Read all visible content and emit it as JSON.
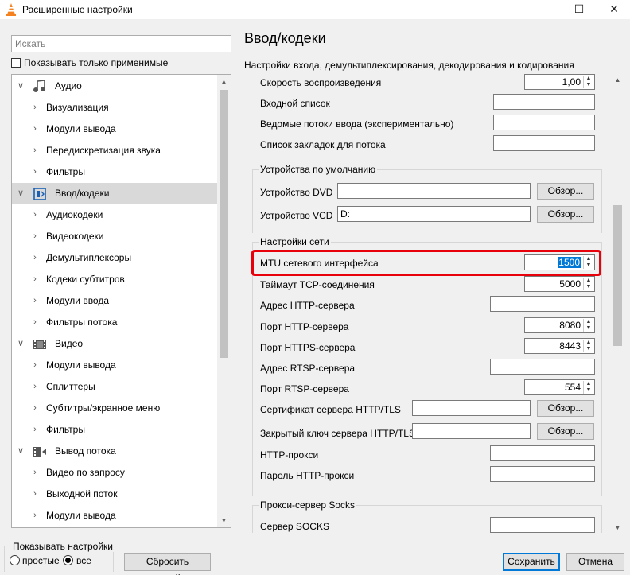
{
  "window": {
    "title": "Расширенные настройки",
    "minimize": "—",
    "maximize": "☐",
    "close": "✕"
  },
  "left": {
    "search_placeholder": "Искать",
    "show_applied_label": "Показывать только применимые",
    "tree": [
      {
        "label": "Аудио",
        "level": 0,
        "icon": "audio-note-icon",
        "expanded": true
      },
      {
        "label": "Визуализация",
        "level": 1
      },
      {
        "label": "Модули вывода",
        "level": 1
      },
      {
        "label": "Передискретизация звука",
        "level": 1
      },
      {
        "label": "Фильтры",
        "level": 1
      },
      {
        "label": "Ввод/кодеки",
        "level": 0,
        "icon": "input-codecs-icon",
        "expanded": true,
        "selected": true
      },
      {
        "label": "Аудиокодеки",
        "level": 1
      },
      {
        "label": "Видеокодеки",
        "level": 1
      },
      {
        "label": "Демультиплексоры",
        "level": 1
      },
      {
        "label": "Кодеки субтитров",
        "level": 1
      },
      {
        "label": "Модули ввода",
        "level": 1
      },
      {
        "label": "Фильтры потока",
        "level": 1
      },
      {
        "label": "Видео",
        "level": 0,
        "icon": "video-film-icon",
        "expanded": true
      },
      {
        "label": "Модули вывода",
        "level": 1
      },
      {
        "label": "Сплиттеры",
        "level": 1
      },
      {
        "label": "Субтитры/экранное меню",
        "level": 1
      },
      {
        "label": "Фильтры",
        "level": 1
      },
      {
        "label": "Вывод потока",
        "level": 0,
        "icon": "stream-output-icon",
        "expanded": true
      },
      {
        "label": "Видео по запросу",
        "level": 1
      },
      {
        "label": "Выходной поток",
        "level": 1
      },
      {
        "label": "Модули вывода",
        "level": 1
      }
    ]
  },
  "right": {
    "title": "Ввод/кодеки",
    "description": "Настройки входа, демультиплексирования, декодирования и кодирования",
    "playback_speed_label": "Скорость воспроизведения",
    "playback_speed_value": "1,00",
    "input_list_label": "Входной список",
    "input_list_value": "",
    "slave_streams_label": "Ведомые потоки ввода (экспериментально)",
    "slave_streams_value": "",
    "bookmarks_label": "Список закладок для потока",
    "bookmarks_value": "",
    "default_devices_group": "Устройства по умолчанию",
    "dvd_device_label": "Устройство DVD",
    "dvd_device_value": "",
    "vcd_device_label": "Устройство VCD",
    "vcd_device_value": "D:",
    "browse_label": "Обзор...",
    "network_group": "Настройки сети",
    "mtu_label": "MTU сетевого интерфейса",
    "mtu_value": "1500",
    "tcp_timeout_label": "Таймаут TCP-соединения",
    "tcp_timeout_value": "5000",
    "http_address_label": "Адрес HTTP-сервера",
    "http_address_value": "",
    "http_port_label": "Порт HTTP-сервера",
    "http_port_value": "8080",
    "https_port_label": "Порт HTTPS-сервера",
    "https_port_value": "8443",
    "rtsp_address_label": "Адрес RTSP-сервера",
    "rtsp_address_value": "",
    "rtsp_port_label": "Порт RTSP-сервера",
    "rtsp_port_value": "554",
    "http_cert_label": "Сертификат сервера HTTP/TLS",
    "http_cert_value": "",
    "http_key_label": "Закрытый ключ сервера HTTP/TLS",
    "http_key_value": "",
    "http_proxy_label": "HTTP-прокси",
    "http_proxy_value": "",
    "http_proxy_pwd_label": "Пароль HTTP-прокси",
    "http_proxy_pwd_value": "",
    "socks_group": "Прокси-сервер Socks",
    "socks_server_label": "Сервер SOCKS",
    "socks_server_value": ""
  },
  "bottom": {
    "show_settings_label": "Показывать настройки",
    "simple_label": "простые",
    "all_label": "все",
    "selected_mode": "все",
    "reset_label": "Сбросить настройки",
    "save_label": "Сохранить",
    "cancel_label": "Отмена"
  },
  "colors": {
    "highlight": "#e8000b",
    "selection": "#0078d7",
    "vlc_orange": "#f58220"
  }
}
